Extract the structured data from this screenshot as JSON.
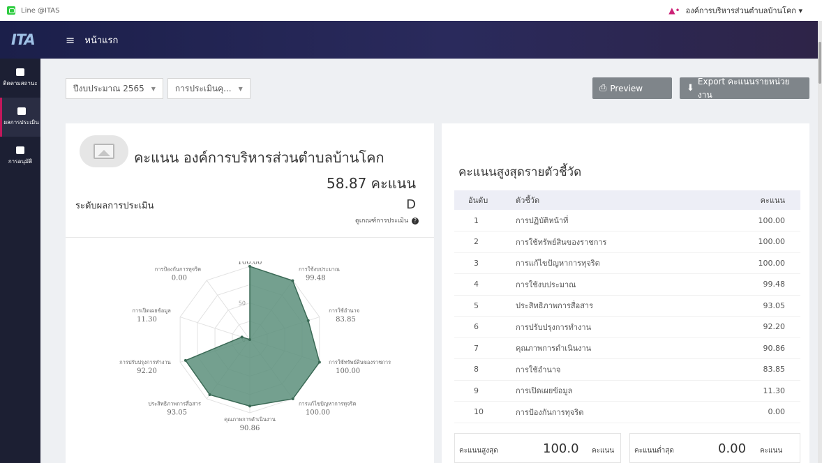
{
  "topbar": {
    "line_label": "Line @ITAS",
    "org_name": "องค์การบริหารส่วนตำบลบ้านโคก",
    "caret": "▾"
  },
  "navbar": {
    "logo": "ITA",
    "menu_icon": "≡",
    "home": "หน้าแรก"
  },
  "sidebar": {
    "items": [
      {
        "label": "ติดตามสถานะ",
        "icon": "chart-icon"
      },
      {
        "label": "ผลการประเมิน",
        "icon": "document-icon"
      },
      {
        "label": "การอนุมัติ",
        "icon": "clipboard-check-icon"
      }
    ]
  },
  "filters": {
    "year": "ปีงบประมาณ 2565",
    "assessment": "การประเมินคุ...",
    "caret": "▼"
  },
  "buttons": {
    "preview": "Preview",
    "export": "Export คะแนนรายหน่วยงาน"
  },
  "summary": {
    "title": "คะแนน องค์การบริหารส่วนตำบลบ้านโคก",
    "total": "58.87 คะแนน",
    "level_label": "ระดับผลการประเมิน",
    "level_value": "D",
    "criteria_link": "ดูเกณฑ์การประเมิน",
    "criteria_icon": "?"
  },
  "chart_data": {
    "type": "radar",
    "range": [
      0,
      100
    ],
    "grid_ticks": [
      0,
      50,
      100
    ],
    "grid_tick_labels": [
      "0",
      "50"
    ],
    "axes": [
      {
        "label": "การปฏิบัติหน้าที่",
        "value": 100.0,
        "value_label": "100.00"
      },
      {
        "label": "การใช้งบประมาณ",
        "value": 99.48,
        "value_label": "99.48"
      },
      {
        "label": "การใช้อำนาจ",
        "value": 83.85,
        "value_label": "83.85"
      },
      {
        "label": "การใช้ทรัพย์สินของราชการ",
        "value": 100.0,
        "value_label": "100.00"
      },
      {
        "label": "การแก้ไขปัญหาการทุจริต",
        "value": 100.0,
        "value_label": "100.00"
      },
      {
        "label": "คุณภาพการดำเนินงาน",
        "value": 90.86,
        "value_label": "90.86"
      },
      {
        "label": "ประสิทธิภาพการสื่อสาร",
        "value": 93.05,
        "value_label": "93.05"
      },
      {
        "label": "การปรับปรุงการทำงาน",
        "value": 92.2,
        "value_label": "92.20"
      },
      {
        "label": "การเปิดเผยข้อมูล",
        "value": 11.3,
        "value_label": "11.30"
      },
      {
        "label": "การป้องกันการทุจริต",
        "value": 0.0,
        "value_label": "0.00"
      }
    ],
    "fill_color": "#5c8f7b",
    "stroke_color": "#3b6a56"
  },
  "ranking": {
    "title": "คะแนนสูงสุดรายตัวชี้วัด",
    "headers": [
      "อันดับ",
      "ตัวชี้วัด",
      "คะแนน"
    ],
    "rows": [
      [
        "1",
        "การปฏิบัติหน้าที่",
        "100.00"
      ],
      [
        "2",
        "การใช้ทรัพย์สินของราชการ",
        "100.00"
      ],
      [
        "3",
        "การแก้ไขปัญหาการทุจริต",
        "100.00"
      ],
      [
        "4",
        "การใช้งบประมาณ",
        "99.48"
      ],
      [
        "5",
        "ประสิทธิภาพการสื่อสาร",
        "93.05"
      ],
      [
        "6",
        "การปรับปรุงการทำงาน",
        "92.20"
      ],
      [
        "7",
        "คุณภาพการดำเนินงาน",
        "90.86"
      ],
      [
        "8",
        "การใช้อำนาจ",
        "83.85"
      ],
      [
        "9",
        "การเปิดเผยข้อมูล",
        "11.30"
      ],
      [
        "10",
        "การป้องกันการทุจริต",
        "0.00"
      ]
    ]
  },
  "stats": {
    "max_label": "คะแนนสูงสุด",
    "max_value": "100.0",
    "min_label": "คะแนนต่ำสุด",
    "min_value": "0.00",
    "unit": "คะแนน"
  },
  "colors": {
    "accent": "#c2185b",
    "button": "#7f858a",
    "navbar": "#1b1f4a"
  }
}
